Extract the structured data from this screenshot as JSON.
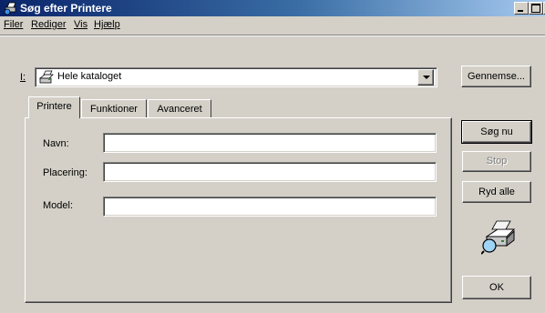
{
  "window": {
    "title": "Søg efter Printere"
  },
  "menu": [
    {
      "label": "Filer"
    },
    {
      "label": "Rediger"
    },
    {
      "label": "Vis"
    },
    {
      "label": "Hjælp"
    }
  ],
  "location": {
    "label": "I:",
    "value": "Hele kataloget",
    "browse_button": "Gennemse..."
  },
  "tabs": [
    {
      "label": "Printere",
      "active": true
    },
    {
      "label": "Funktioner",
      "active": false
    },
    {
      "label": "Avanceret",
      "active": false
    }
  ],
  "fields": {
    "name_label": "Navn:",
    "name_value": "",
    "location_label": "Placering:",
    "location_value": "",
    "model_label": "Model:",
    "model_value": ""
  },
  "buttons": {
    "search_now": "Søg nu",
    "stop": "Stop",
    "clear_all": "Ryd alle",
    "ok": "OK"
  },
  "icons": {
    "title": "printer-search-icon",
    "catalog": "printer-catalog-icon",
    "search_animation": "printer-search-animation-icon"
  }
}
